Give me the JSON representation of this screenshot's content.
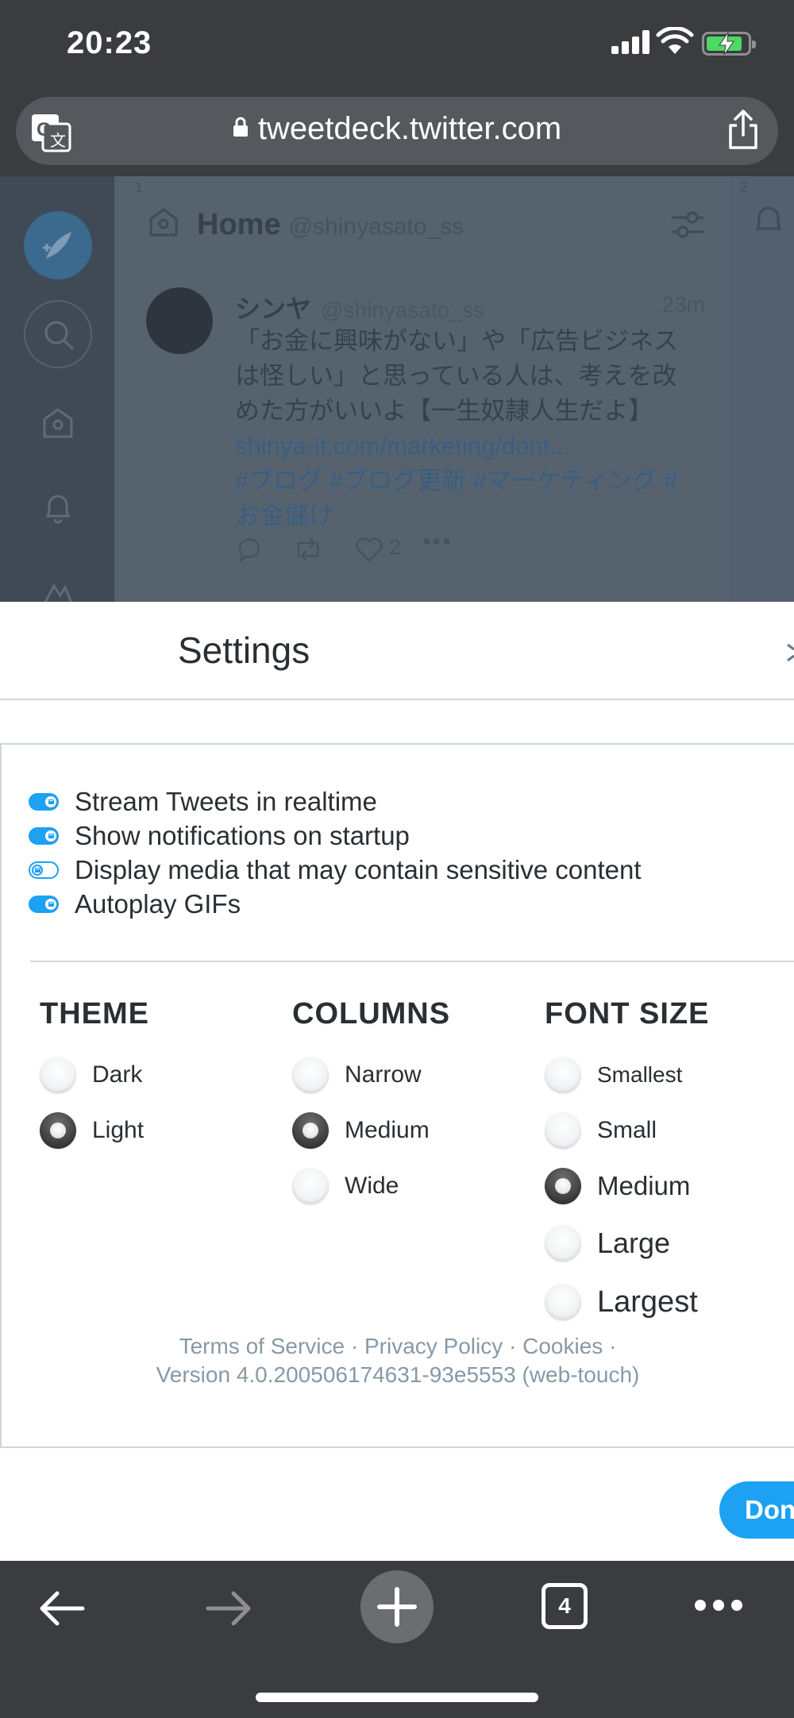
{
  "status_bar": {
    "time": "20:23"
  },
  "browser": {
    "url": "tweetdeck.twitter.com",
    "tab_count": "4"
  },
  "background_app": {
    "column_title": "Home",
    "column_handle": "@shinyasato_ss",
    "column_numbers": [
      "1",
      "2"
    ],
    "tweet": {
      "name": "シンヤ",
      "handle": "@shinyasato_ss",
      "time": "23m",
      "text_lines": [
        "「お金に興味がない」や「広告ビジネス",
        "は怪しい」と思っている人は、考えを改",
        "めた方がいいよ【一生奴隷人生だよ】"
      ],
      "link": "shinya-it.com/marketing/dont...",
      "hashtags_lines": [
        "#ブログ #ブログ更新 #マーケティング #",
        "お金儲け"
      ],
      "like_count": "2"
    }
  },
  "settings": {
    "title": "Settings",
    "toggles": [
      {
        "label": "Stream Tweets in realtime",
        "on": true
      },
      {
        "label": "Show notifications on startup",
        "on": true
      },
      {
        "label": "Display media that may contain sensitive content",
        "on": false
      },
      {
        "label": "Autoplay GIFs",
        "on": true
      }
    ],
    "theme": {
      "heading": "THEME",
      "options": [
        "Dark",
        "Light"
      ],
      "selected": "Light"
    },
    "columns": {
      "heading": "COLUMNS",
      "options": [
        "Narrow",
        "Medium",
        "Wide"
      ],
      "selected": "Medium"
    },
    "font_size": {
      "heading": "FONT SIZE",
      "options": [
        "Smallest",
        "Small",
        "Medium",
        "Large",
        "Largest"
      ],
      "selected": "Medium"
    },
    "footer": {
      "terms": "Terms of Service",
      "privacy": "Privacy Policy",
      "cookies": "Cookies",
      "separator": "·",
      "version": "Version 4.0.200506174631-93e5553 (web-touch)"
    },
    "done_label": "Done"
  },
  "colors": {
    "accent": "#1da1f2",
    "chrome": "#3a3c3f"
  }
}
